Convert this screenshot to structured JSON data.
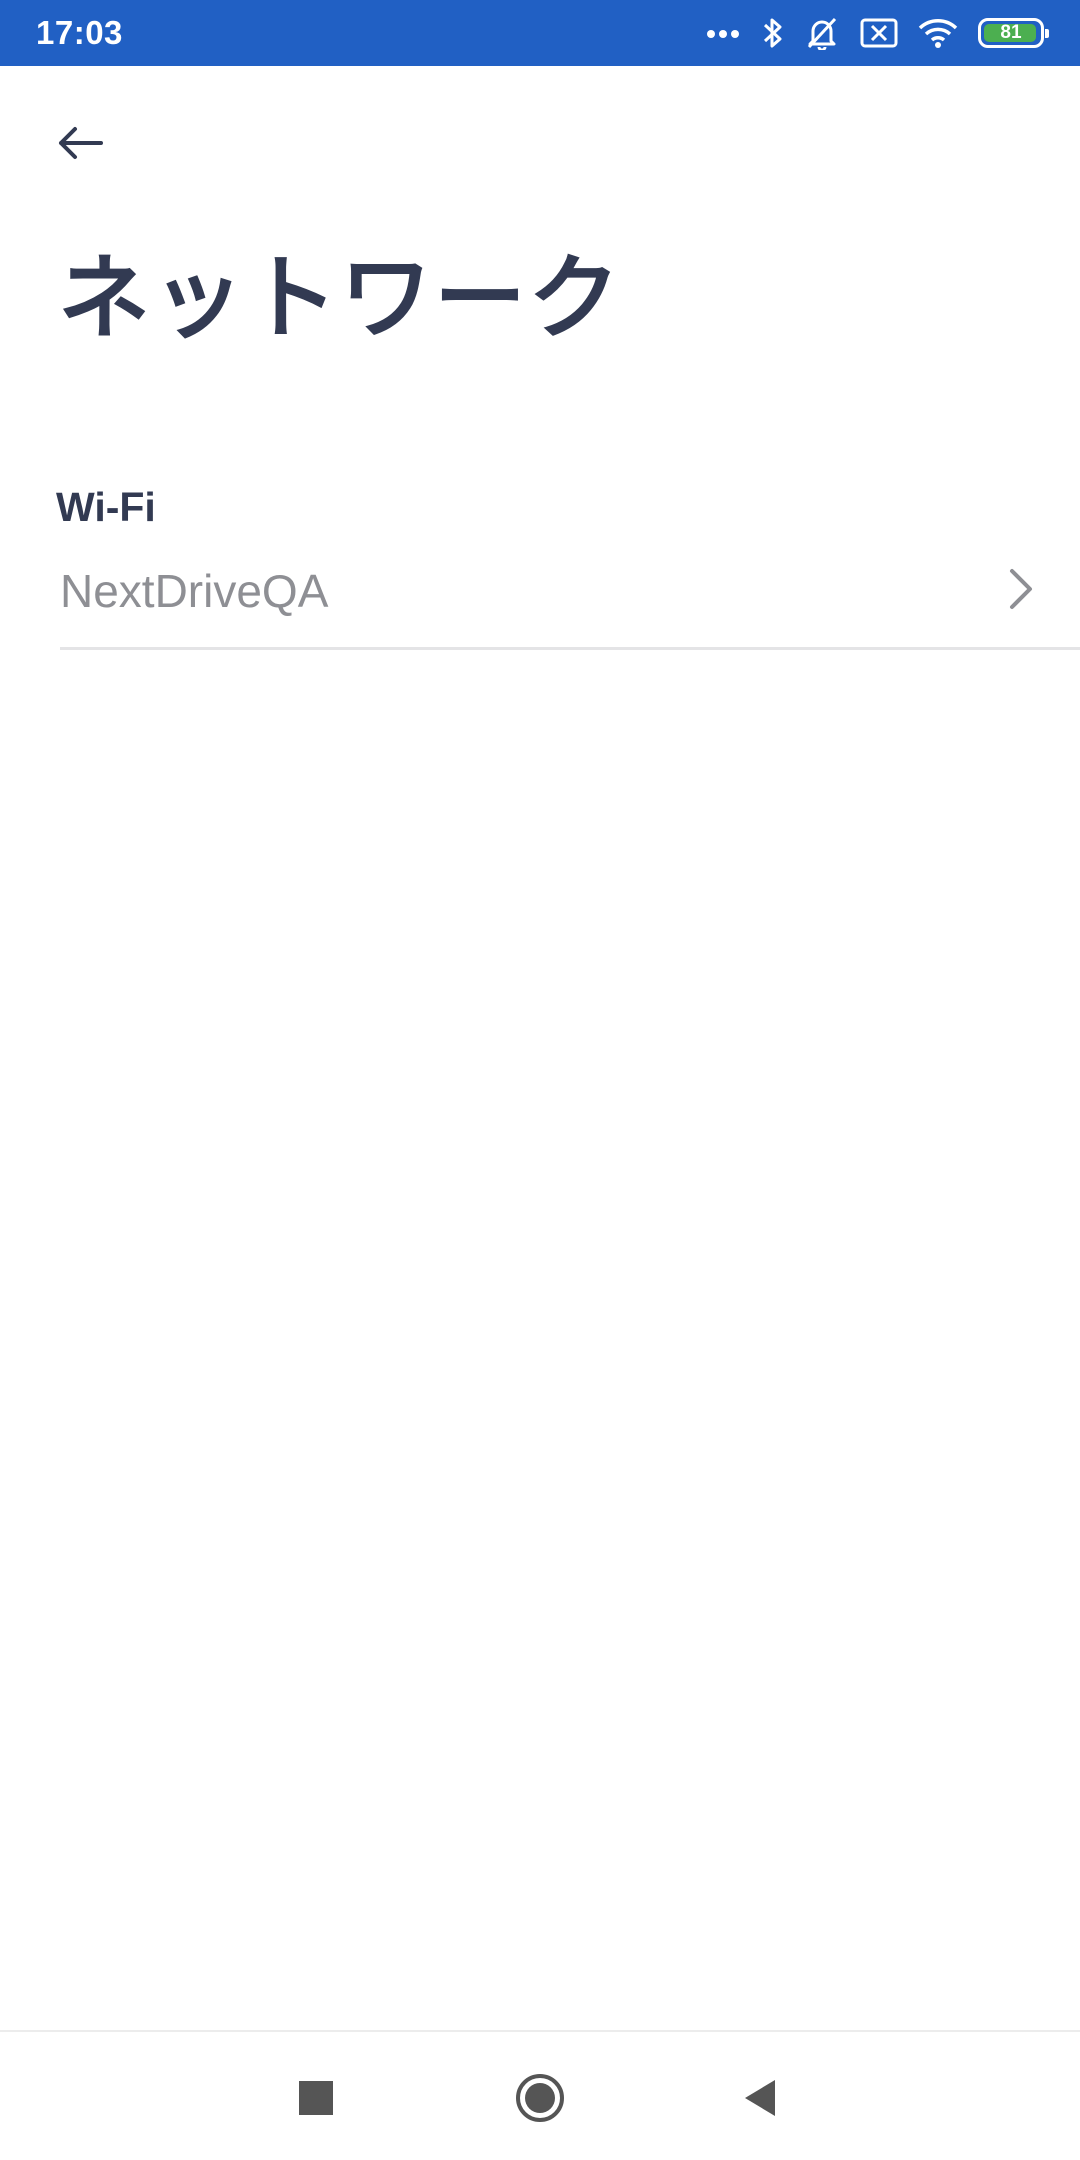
{
  "status_bar": {
    "time": "17:03",
    "battery": "81",
    "battery_level_percent": 81,
    "background_color": "#2160c4",
    "icons": [
      "more-dots-icon",
      "bluetooth-icon",
      "mute-icon",
      "sim-off-icon",
      "wifi-icon",
      "battery-icon"
    ]
  },
  "header": {
    "back_icon": "arrow-left-icon",
    "title": "ネットワーク"
  },
  "wifi_section": {
    "label": "Wi-Fi",
    "value": "NextDriveQA",
    "chevron_icon": "chevron-right-icon"
  },
  "nav_bar": {
    "icons": [
      "recents-square-icon",
      "home-circle-icon",
      "back-triangle-icon"
    ]
  },
  "colors": {
    "title": "#323a52",
    "secondary_text": "#8e8f94",
    "divider": "#e4e4e6"
  }
}
